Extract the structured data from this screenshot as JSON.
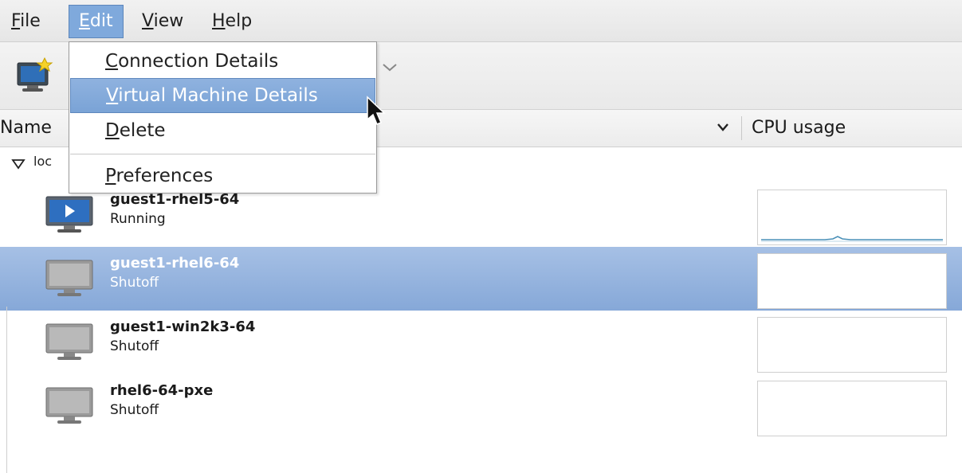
{
  "menubar": {
    "items": [
      {
        "label": "File"
      },
      {
        "label": "Edit",
        "active": true
      },
      {
        "label": "View"
      },
      {
        "label": "Help"
      }
    ]
  },
  "edit_menu": {
    "items": [
      {
        "label": "Connection Details"
      },
      {
        "label": "Virtual Machine Details",
        "highlighted": true
      },
      {
        "label": "Delete"
      },
      {
        "label": "Preferences"
      }
    ]
  },
  "columns": {
    "name": "Name",
    "cpu": "CPU usage"
  },
  "connection": {
    "label": "loc"
  },
  "vms": [
    {
      "name": "guest1-rhel5-64",
      "status": "Running",
      "icon": "vm-running-icon"
    },
    {
      "name": "guest1-rhel6-64",
      "status": "Shutoff",
      "icon": "vm-shutoff-icon",
      "selected": true
    },
    {
      "name": "guest1-win2k3-64",
      "status": "Shutoff",
      "icon": "vm-shutoff-icon"
    },
    {
      "name": "rhel6-64-pxe",
      "status": "Shutoff",
      "icon": "vm-shutoff-icon"
    }
  ],
  "colors": {
    "selection": "#8eaedb",
    "menu_active": "#7fa9dc",
    "graph_line": "#4a90b8"
  }
}
